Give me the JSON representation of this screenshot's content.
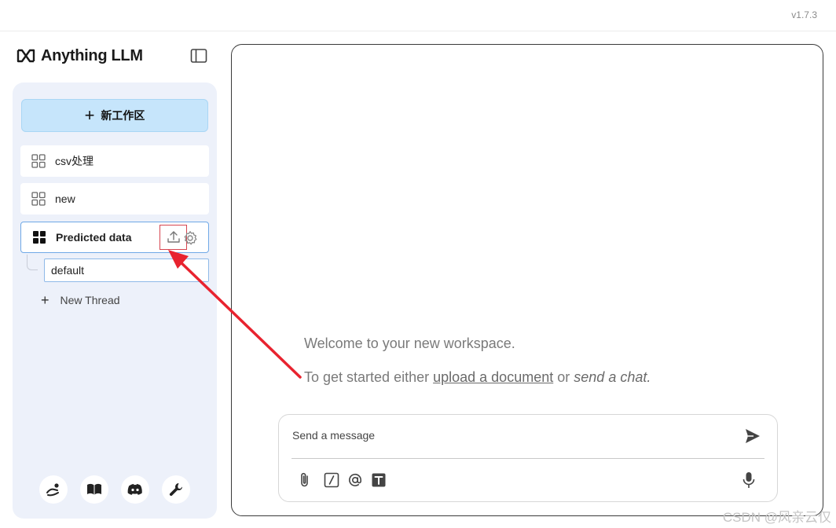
{
  "app": {
    "version": "v1.7.3",
    "brand": "Anything LLM"
  },
  "sidebar": {
    "new_workspace_label": "新工作区",
    "workspaces": [
      {
        "label": "csv处理"
      },
      {
        "label": "new"
      },
      {
        "label": "Predicted data",
        "active": true
      }
    ],
    "threads": [
      {
        "label": "default"
      }
    ],
    "new_thread_label": "New Thread",
    "footer_icons": [
      "community-hub-icon",
      "docs-book-icon",
      "discord-icon",
      "settings-wrench-icon"
    ]
  },
  "chat": {
    "welcome": "Welcome to your new workspace.",
    "get_started_prefix": "To get started either",
    "upload_link": "upload a document",
    "or_text": "or",
    "send_chat_link": "send a chat.",
    "input_placeholder": "Send a message",
    "tools": [
      "attachment-icon",
      "slash-command-icon",
      "at-mention-icon",
      "text-size-icon",
      "microphone-icon"
    ]
  },
  "colors": {
    "accent_button": "#c6e5fb",
    "sidebar_bg": "#edf1fa",
    "active_border": "#6fa8e6",
    "annotation_arrow": "#e8232f"
  },
  "watermark": "CSDN @风亲云仅"
}
